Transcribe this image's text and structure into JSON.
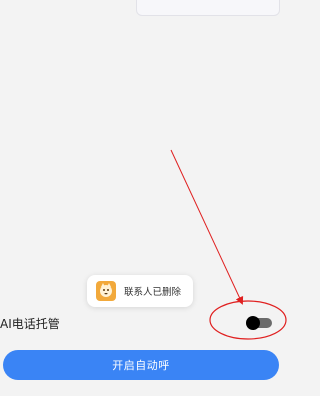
{
  "toast": {
    "text": "联系人已删除",
    "icon": "cartoon-cat-app-icon"
  },
  "setting": {
    "label": "AI电话托管",
    "toggle_on": true
  },
  "primary_button": {
    "label": "开启自动呼"
  },
  "colors": {
    "background": "#f3f3f3",
    "primary": "#3a84f5",
    "annotation": "#e02020"
  }
}
